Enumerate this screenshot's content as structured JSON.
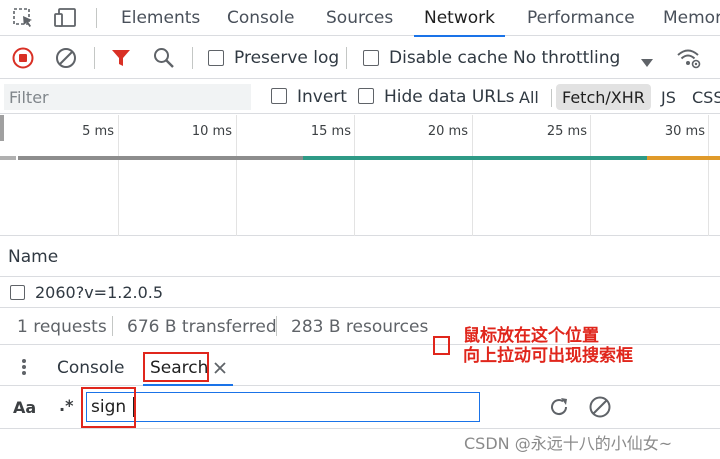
{
  "tabs": [
    "Elements",
    "Console",
    "Sources",
    "Network",
    "Performance",
    "Memor"
  ],
  "toolbar": {
    "preserve_log": "Preserve log",
    "disable_cache": "Disable cache",
    "throttling": "No throttling"
  },
  "filter": {
    "placeholder": "Filter",
    "invert": "Invert",
    "hide_data_urls": "Hide data URLs",
    "all": "All",
    "fetch_xhr": "Fetch/XHR",
    "js": "JS",
    "css": "CSS"
  },
  "timeline": {
    "ticks": [
      "5 ms",
      "10 ms",
      "15 ms",
      "20 ms",
      "25 ms",
      "30 ms"
    ]
  },
  "table": {
    "name_header": "Name",
    "rows": [
      "2060?v=1.2.0.5"
    ]
  },
  "status": {
    "requests": "1 requests",
    "transferred": "676 B transferred",
    "resources": "283 B resources"
  },
  "drawer": {
    "console_tab": "Console",
    "search_tab": "Search"
  },
  "search": {
    "aa": "Aa",
    "regex": ".*",
    "value": "sign"
  },
  "annotation": {
    "line1": "鼠标放在这个位置",
    "line2": "向上拉动可出现搜索框"
  },
  "watermark": "CSDN @永远十八的小仙女~",
  "colors": {
    "record_red": "#d93025",
    "accent_blue": "#1a73e8",
    "annotation_red": "#e0261c",
    "bar_gray": "#8d8d8d",
    "bar_teal": "#2e9a86",
    "bar_orange": "#e09a2a"
  }
}
